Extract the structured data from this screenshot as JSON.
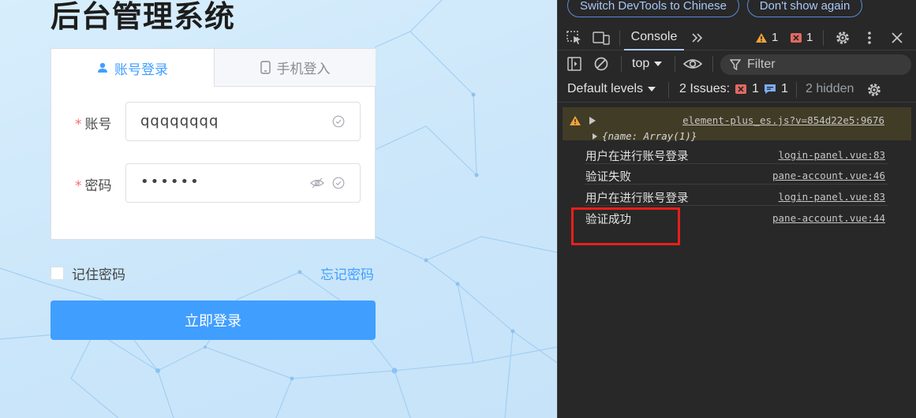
{
  "app": {
    "title": "后台管理系统",
    "tabs": [
      {
        "label": "账号登录",
        "icon": "user-icon",
        "active": true
      },
      {
        "label": "手机登入",
        "icon": "phone-icon",
        "active": false
      }
    ],
    "form": {
      "account_label": "账号",
      "account_value": "qqqqqqqq",
      "password_label": "密码",
      "password_value": "••••••",
      "required_mark": "*"
    },
    "remember_label": "记住密码",
    "forgot_label": "忘记密码",
    "login_button": "立即登录",
    "accent_color": "#409eff"
  },
  "devtools": {
    "info_bar": {
      "switch_label": "Switch DevTools to Chinese",
      "dismiss_label": "Don't show again"
    },
    "tabs": {
      "console_label": "Console",
      "more_tabs_icon": "chevron-double-right-icon",
      "warning_count": "1",
      "error_count": "1"
    },
    "toolbar": {
      "context": "top",
      "filter_placeholder": "Filter",
      "levels": "Default levels",
      "issues_label": "2 Issues:",
      "issues_error_count": "1",
      "issues_info_count": "1",
      "hidden_label": "2 hidden"
    },
    "console": {
      "warning": {
        "source": "element-plus_es.js?v=854d22e5:9676",
        "object": "{name: Array(1)}"
      },
      "logs": [
        {
          "message": "用户在进行账号登录",
          "source": "login-panel.vue:83"
        },
        {
          "message": "验证失败",
          "source": "pane-account.vue:46"
        },
        {
          "message": "用户在进行账号登录",
          "source": "login-panel.vue:83"
        },
        {
          "message": "验证成功",
          "source": "pane-account.vue:44"
        }
      ]
    },
    "highlight_color": "#e8201a"
  }
}
